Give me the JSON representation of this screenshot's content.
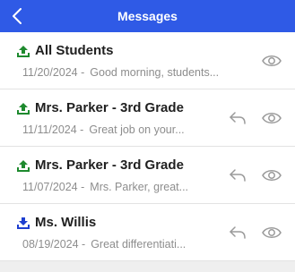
{
  "header": {
    "title": "Messages"
  },
  "colors": {
    "header_bg": "#2f5ae6",
    "sent_icon": "#1e8a2e",
    "received_icon": "#1e3fd0"
  },
  "messages": [
    {
      "sender": "All Students",
      "date": "11/20/2024 -",
      "preview": "Good morning, students...",
      "direction": "sent",
      "reply": false
    },
    {
      "sender": "Mrs. Parker - 3rd Grade",
      "date": "11/11/2024 -",
      "preview": "Great job on your...",
      "direction": "sent",
      "reply": true
    },
    {
      "sender": "Mrs. Parker - 3rd Grade",
      "date": "11/07/2024 -",
      "preview": "Mrs. Parker, great...",
      "direction": "sent",
      "reply": true
    },
    {
      "sender": "Ms. Willis",
      "date": "08/19/2024 -",
      "preview": "Great differentiati...",
      "direction": "received",
      "reply": true
    }
  ]
}
